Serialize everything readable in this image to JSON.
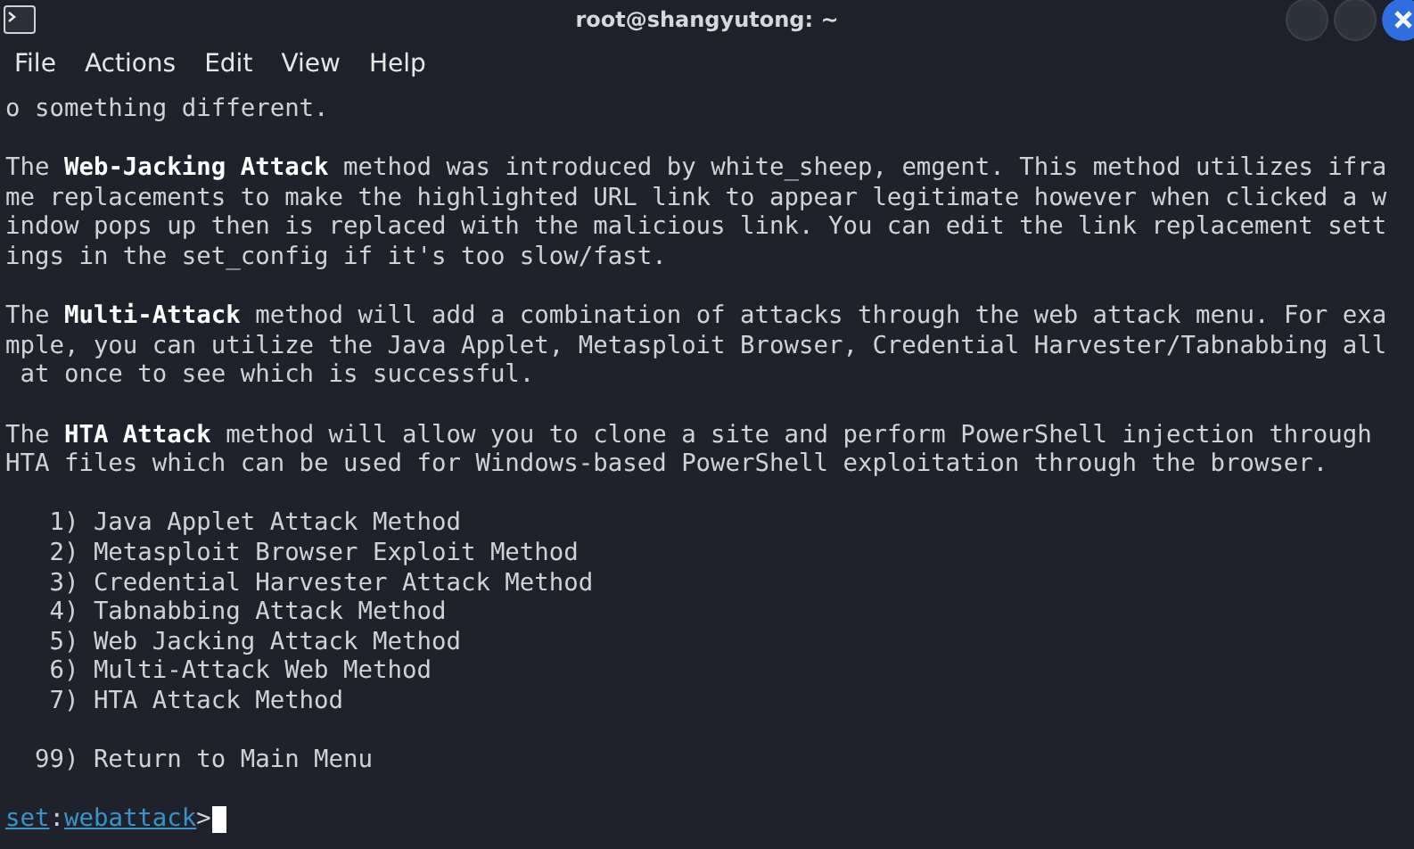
{
  "window": {
    "title": "root@shangyutong: ~"
  },
  "menu": [
    "File",
    "Actions",
    "Edit",
    "View",
    "Help"
  ],
  "terminal": {
    "lines": [
      {
        "kind": "text",
        "text": "o something different."
      },
      {
        "kind": "blank"
      },
      {
        "kind": "text",
        "text": "The **Web-Jacking Attack** method was introduced by white_sheep, emgent. This method utilizes ifra"
      },
      {
        "kind": "text",
        "text": "me replacements to make the highlighted URL link to appear legitimate however when clicked a w"
      },
      {
        "kind": "text",
        "text": "indow pops up then is replaced with the malicious link. You can edit the link replacement sett"
      },
      {
        "kind": "text",
        "text": "ings in the set_config if it's too slow/fast."
      },
      {
        "kind": "blank"
      },
      {
        "kind": "text",
        "text": "The **Multi-Attack** method will add a combination of attacks through the web attack menu. For exa"
      },
      {
        "kind": "text",
        "text": "mple, you can utilize the Java Applet, Metasploit Browser, Credential Harvester/Tabnabbing all"
      },
      {
        "kind": "text",
        "text": " at once to see which is successful."
      },
      {
        "kind": "blank"
      },
      {
        "kind": "text",
        "text": "The **HTA Attack** method will allow you to clone a site and perform PowerShell injection through"
      },
      {
        "kind": "text",
        "text": "HTA files which can be used for Windows-based PowerShell exploitation through the browser."
      },
      {
        "kind": "blank"
      },
      {
        "kind": "option",
        "text": "   1) Java Applet Attack Method"
      },
      {
        "kind": "option",
        "text": "   2) Metasploit Browser Exploit Method"
      },
      {
        "kind": "option",
        "text": "   3) Credential Harvester Attack Method"
      },
      {
        "kind": "option",
        "text": "   4) Tabnabbing Attack Method"
      },
      {
        "kind": "option",
        "text": "   5) Web Jacking Attack Method"
      },
      {
        "kind": "option",
        "text": "   6) Multi-Attack Web Method"
      },
      {
        "kind": "option",
        "text": "   7) HTA Attack Method"
      },
      {
        "kind": "blank"
      },
      {
        "kind": "option",
        "text": "  99) Return to Main Menu"
      },
      {
        "kind": "blank"
      }
    ],
    "prompt": {
      "module": "set",
      "separator": ":",
      "context": "webattack",
      "symbol": ">"
    }
  }
}
